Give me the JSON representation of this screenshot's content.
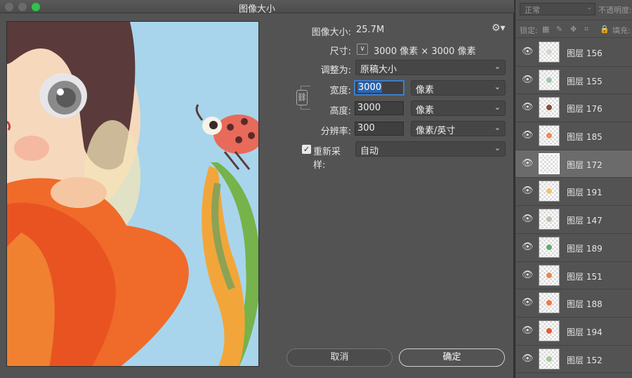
{
  "window": {
    "title": "图像大小"
  },
  "form": {
    "image_size_label": "图像大小:",
    "image_size_value": "25.7M",
    "dimensions_label": "尺寸:",
    "dimensions_value": "3000 像素 × 3000 像素",
    "fit_to_label": "调整为:",
    "fit_to_value": "原稿大小",
    "width_label": "宽度:",
    "width_value": "3000",
    "width_unit": "像素",
    "height_label": "高度:",
    "height_value": "3000",
    "height_unit": "像素",
    "resolution_label": "分辨率:",
    "resolution_value": "300",
    "resolution_unit": "像素/英寸",
    "resample_label": "重新采样:",
    "resample_value": "自动",
    "resample_checked": true
  },
  "buttons": {
    "cancel": "取消",
    "ok": "确定"
  },
  "layers_panel": {
    "blend_mode": "正常",
    "opacity_label": "不透明度:",
    "lock_label": "锁定:",
    "fill_label": "填充:",
    "layers": [
      {
        "name": "图层 156",
        "selected": false,
        "thumb_color": "#cfd9c8"
      },
      {
        "name": "图层 155",
        "selected": false,
        "thumb_color": "#9cc7a6"
      },
      {
        "name": "图层 176",
        "selected": false,
        "thumb_color": "#8a4e3a"
      },
      {
        "name": "图层 185",
        "selected": false,
        "thumb_color": "#f08a5a"
      },
      {
        "name": "图层 172",
        "selected": true,
        "thumb_color": ""
      },
      {
        "name": "图层 191",
        "selected": false,
        "thumb_color": "#f2c36a"
      },
      {
        "name": "图层 147",
        "selected": false,
        "thumb_color": "#b9c4a8"
      },
      {
        "name": "图层 189",
        "selected": false,
        "thumb_color": "#5fae6a"
      },
      {
        "name": "图层 151",
        "selected": false,
        "thumb_color": "#e58a4a"
      },
      {
        "name": "图层 188",
        "selected": false,
        "thumb_color": "#f07a4a"
      },
      {
        "name": "图层 194",
        "selected": false,
        "thumb_color": "#e85a3a"
      },
      {
        "name": "图层 152",
        "selected": false,
        "thumb_color": "#a7c79a"
      }
    ]
  }
}
